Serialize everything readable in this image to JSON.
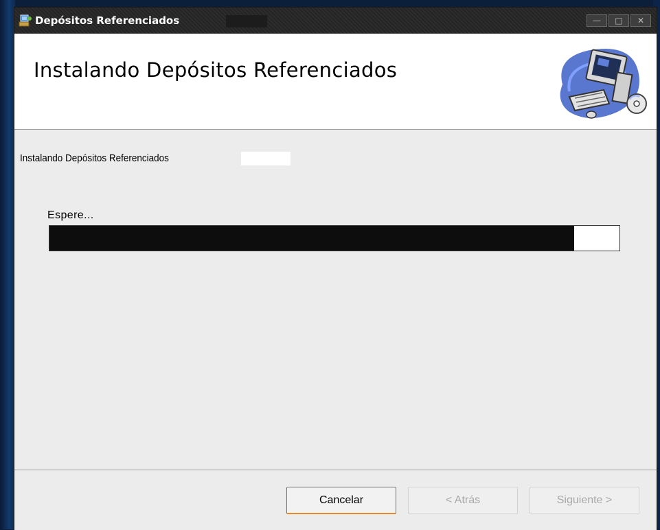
{
  "window": {
    "title": "Depósitos Referenciados",
    "controls": {
      "minimize": "—",
      "maximize": "□",
      "close": "✕"
    }
  },
  "header": {
    "title": "Instalando Depósitos Referenciados",
    "art_icon": "computer-cd-icon"
  },
  "main": {
    "status": "Instalando Depósitos Referenciados",
    "wait_label": "Espere...",
    "progress_fraction": 0.92
  },
  "footer": {
    "cancel_label": "Cancelar",
    "back_label": "< Atrás",
    "next_label": "Siguiente >"
  },
  "colors": {
    "accent": "#e58a2a",
    "progress_fill": "#0d0d0d",
    "titlebar": "#2d2d2d"
  }
}
